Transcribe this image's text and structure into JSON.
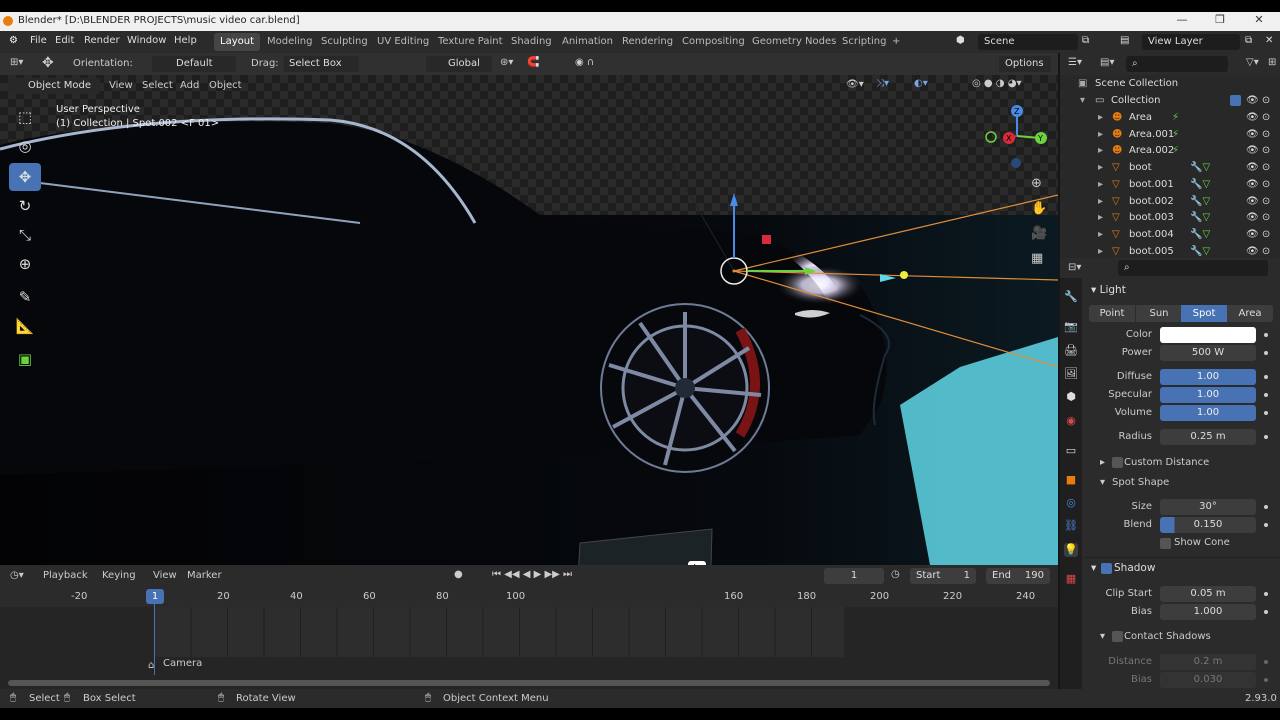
{
  "window": {
    "title": "Blender* [D:\\BLENDER PROJECTS\\music video car.blend]",
    "min": "—",
    "max": "❐",
    "close": "✕"
  },
  "menus": [
    "File",
    "Edit",
    "Render",
    "Window",
    "Help"
  ],
  "workspaces": [
    "Layout",
    "Modeling",
    "Sculpting",
    "UV Editing",
    "Texture Paint",
    "Shading",
    "Animation",
    "Rendering",
    "Compositing",
    "Geometry Nodes",
    "Scripting"
  ],
  "scene": "Scene",
  "view_layer": "View Layer",
  "toolheader": {
    "orientation_label": "Orientation:",
    "orientation": "Default",
    "drag_label": "Drag:",
    "drag": "Select Box",
    "transform": "Global",
    "options": "Options"
  },
  "viewport": {
    "mode": "Object Mode",
    "menus": [
      "View",
      "Select",
      "Add",
      "Object"
    ],
    "info1": "User Perspective",
    "info2": "(1) Collection | Spot.002 <F 01>"
  },
  "timeline": {
    "menus": [
      "Playback",
      "Keying",
      "View",
      "Marker"
    ],
    "current_frame": "1",
    "start_label": "Start",
    "start": "1",
    "end_label": "End",
    "end": "190",
    "ticks": [
      "-20",
      "1",
      "20",
      "40",
      "60",
      "80",
      "100",
      "160",
      "180",
      "200",
      "220",
      "240"
    ],
    "marker": "Camera"
  },
  "status": {
    "select": "Select",
    "box_select": "Box Select",
    "rotate": "Rotate View",
    "context": "Object Context Menu",
    "version": "2.93.0"
  },
  "outliner": {
    "root": "Scene Collection",
    "collection": "Collection",
    "items": [
      "Area",
      "Area.001",
      "Area.002",
      "boot",
      "boot.001",
      "boot.002",
      "boot.003",
      "boot.004",
      "boot.005"
    ]
  },
  "props": {
    "section": "Light",
    "types": [
      "Point",
      "Sun",
      "Spot",
      "Area"
    ],
    "active_type": "Spot",
    "color_label": "Color",
    "power_label": "Power",
    "power": "500 W",
    "diffuse_label": "Diffuse",
    "diffuse": "1.00",
    "specular_label": "Specular",
    "specular": "1.00",
    "volume_label": "Volume",
    "volume": "1.00",
    "radius_label": "Radius",
    "radius": "0.25 m",
    "custom_distance": "Custom Distance",
    "spot_shape": "Spot Shape",
    "size_label": "Size",
    "size": "30°",
    "blend_label": "Blend",
    "blend": "0.150",
    "show_cone": "Show Cone",
    "shadow": "Shadow",
    "clip_start_label": "Clip Start",
    "clip_start": "0.05 m",
    "bias_label": "Bias",
    "bias": "1.000",
    "contact_shadows": "Contact Shadows",
    "distance_label": "Distance",
    "distance": "0.2 m",
    "bias2_label": "Bias",
    "bias2": "0.030",
    "light_color": "#ffffff"
  },
  "colors": {
    "accent": "#4772b3",
    "orange": "#e87d0d"
  }
}
